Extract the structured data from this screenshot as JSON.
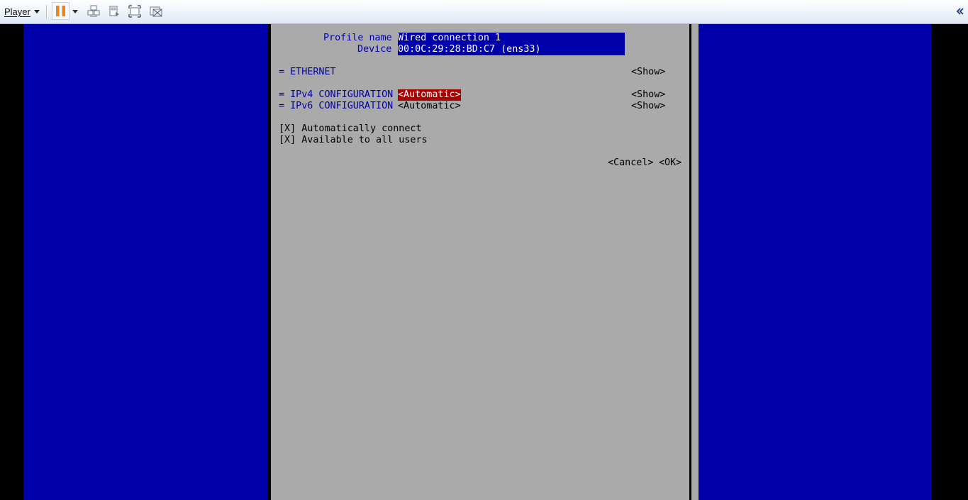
{
  "toolbar": {
    "player_label": "Player",
    "icons": [
      "player-dropdown-icon",
      "pause-icon",
      "pause-dropdown-icon",
      "send-ctrl-alt-del-icon",
      "removable-devices-icon",
      "fullscreen-icon",
      "unity-icon",
      "collapse-toolbar-icon"
    ],
    "accent": "#e0862b"
  },
  "form": {
    "profile_name_label": "Profile name",
    "profile_name_value": "Wired connection 1",
    "device_label": "Device",
    "device_value": "00:0C:29:28:BD:C7 (ens33)",
    "ethernet_label": "= ETHERNET",
    "ipv4_label": "= IPv4 CONFIGURATION",
    "ipv4_value": "<Automatic>",
    "ipv6_label": "= IPv6 CONFIGURATION",
    "ipv6_value": "<Automatic>",
    "show_label": "<Show>",
    "auto_connect": "[X] Automatically connect",
    "all_users": "[X] Available to all users",
    "cancel_label": "<Cancel>",
    "ok_label": "<OK>"
  },
  "colors": {
    "background_blue": "#0000aa",
    "dialog_gray": "#aaaaaa",
    "focus_red": "#aa0000"
  }
}
